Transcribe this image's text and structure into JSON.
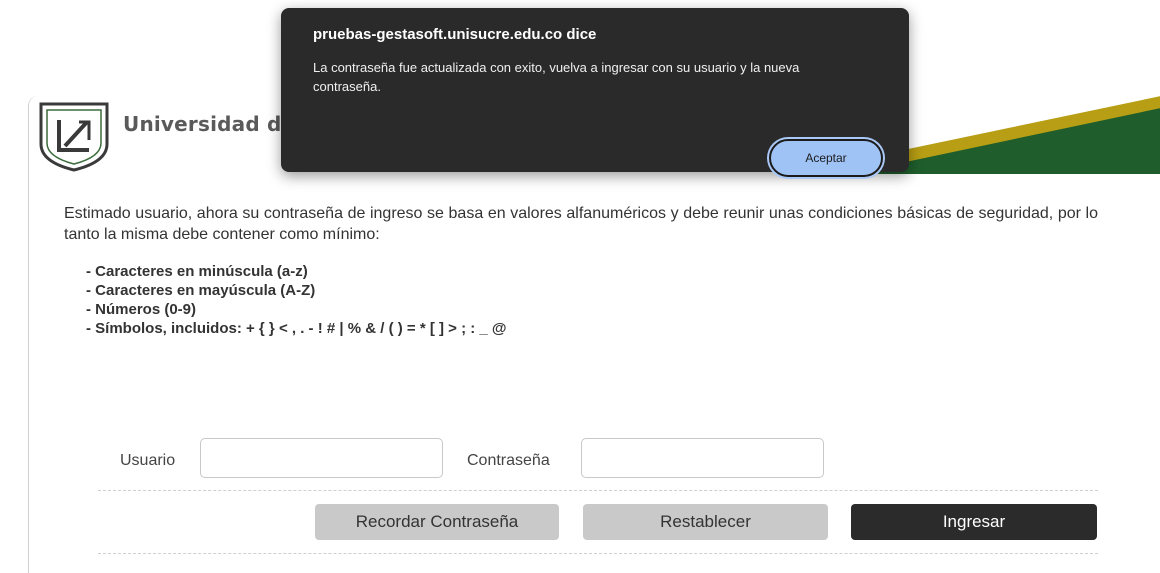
{
  "header": {
    "university_name": "Universidad d"
  },
  "dialog": {
    "title": "pruebas-gestasoft.unisucre.edu.co dice",
    "message": "La contraseña fue actualizada con exito, vuelva a ingresar con su usuario y la nueva contraseña.",
    "ok_label": "Aceptar"
  },
  "content": {
    "intro": "Estimado usuario, ahora su contraseña de ingreso se basa en valores alfanuméricos y debe reunir unas condiciones básicas de seguridad, por lo tanto la misma debe contener como mínimo:",
    "requirements": [
      "- Caracteres en minúscula (a-z)",
      "- Caracteres en mayúscula (A-Z)",
      "- Números (0-9)",
      "- Símbolos, incluidos: + { } < , . - ! # | % & / ( ) = * [ ] > ; : _ @"
    ]
  },
  "form": {
    "username_label": "Usuario",
    "username_value": "",
    "password_label": "Contraseña",
    "password_value": "",
    "remember_button": "Recordar Contraseña",
    "reset_button": "Restablecer",
    "login_button": "Ingresar"
  },
  "colors": {
    "header_green": "#1f5e2c",
    "header_gold": "#b79e14",
    "dialog_bg": "#2a2a2a",
    "dialog_button": "#9fc3f5",
    "login_button": "#2b2b2b"
  }
}
